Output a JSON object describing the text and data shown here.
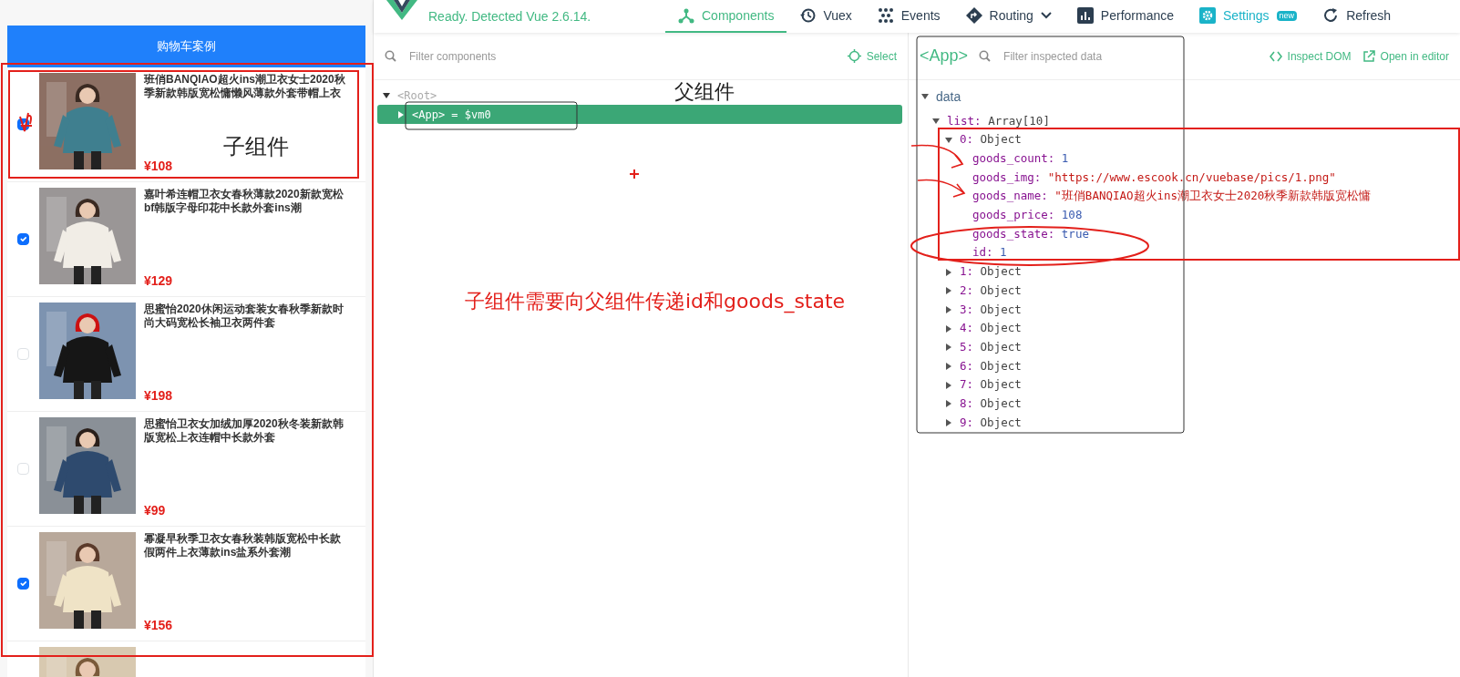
{
  "cart": {
    "title": "购物车案例",
    "items": [
      {
        "name": "班俏BANQIAO超火ins潮卫衣女士2020秋季新款韩版宽松慵懒风薄款外套带帽上衣",
        "price": "¥108",
        "checked": true
      },
      {
        "name": "嘉叶希连帽卫衣女春秋薄款2020新款宽松bf韩版字母印花中长款外套ins潮",
        "price": "¥129",
        "checked": true
      },
      {
        "name": "思蜜怡2020休闲运动套装女春秋季新款时尚大码宽松长袖卫衣两件套",
        "price": "¥198",
        "checked": false
      },
      {
        "name": "思蜜怡卫衣女加绒加厚2020秋冬装新款韩版宽松上衣连帽中长款外套",
        "price": "¥99",
        "checked": false
      },
      {
        "name": "幂凝早秋季卫衣女春秋装韩版宽松中长款假两件上衣薄款ins盐系外套潮",
        "price": "¥156",
        "checked": true
      }
    ]
  },
  "devtools": {
    "status": "Ready. Detected Vue 2.6.14.",
    "tabs": [
      {
        "label": "Components",
        "selected": true
      },
      {
        "label": "Vuex",
        "selected": false
      },
      {
        "label": "Events",
        "selected": false
      },
      {
        "label": "Routing",
        "selected": false,
        "dropdown": true
      },
      {
        "label": "Performance",
        "selected": false
      },
      {
        "label": "Settings",
        "selected": false,
        "badge": "new"
      },
      {
        "label": "Refresh",
        "selected": false
      }
    ],
    "components": {
      "placeholder": "Filter components",
      "select": "Select",
      "tree": [
        {
          "label": "<Root>",
          "expanded": true,
          "selected": false,
          "children": [
            {
              "label": "<App>",
              "suffix": "= $vm0",
              "expanded": false,
              "selected": true
            }
          ]
        }
      ]
    },
    "inspector": {
      "component": "<App>",
      "placeholder": "Filter inspected data",
      "actions": [
        "Inspect DOM",
        "Open in editor"
      ],
      "section": "data",
      "tree": [
        {
          "label": "list:",
          "value": "Array[10]",
          "color": "#444444",
          "expanded": true,
          "children": [
            {
              "label": "0:",
              "value": "Object",
              "color": "#444444",
              "expanded": true,
              "children": [
                {
                  "label": "goods_count:",
                  "value": "1",
                  "color": "#3a5bb0"
                },
                {
                  "label": "goods_img:",
                  "value": "\"https://www.escook.cn/vuebase/pics/1.png\"",
                  "color": "#c41a16"
                },
                {
                  "label": "goods_name:",
                  "value": "\"班俏BANQIAO超火ins潮卫衣女士2020秋季新款韩版宽松慵",
                  "color": "#c41a16"
                },
                {
                  "label": "goods_price:",
                  "value": "108",
                  "color": "#3a5bb0"
                },
                {
                  "label": "goods_state:",
                  "value": "true",
                  "color": "#3a5bb0"
                },
                {
                  "label": "id:",
                  "value": "1",
                  "color": "#3a5bb0"
                }
              ]
            },
            {
              "label": "1:",
              "value": "Object",
              "color": "#444444",
              "expanded": false
            },
            {
              "label": "2:",
              "value": "Object",
              "color": "#444444",
              "expanded": false
            },
            {
              "label": "3:",
              "value": "Object",
              "color": "#444444",
              "expanded": false
            },
            {
              "label": "4:",
              "value": "Object",
              "color": "#444444",
              "expanded": false
            },
            {
              "label": "5:",
              "value": "Object",
              "color": "#444444",
              "expanded": false
            },
            {
              "label": "6:",
              "value": "Object",
              "color": "#444444",
              "expanded": false
            },
            {
              "label": "7:",
              "value": "Object",
              "color": "#444444",
              "expanded": false
            },
            {
              "label": "8:",
              "value": "Object",
              "color": "#444444",
              "expanded": false
            },
            {
              "label": "9:",
              "value": "Object",
              "color": "#444444",
              "expanded": false
            }
          ]
        }
      ]
    }
  },
  "annotations": {
    "labels": [
      {
        "text": "子组件",
        "color": "#222222"
      },
      {
        "text": "父组件",
        "color": "#222222"
      },
      {
        "text": "子组件需要向父组件传递id和goods_state",
        "color": "#e3201b"
      }
    ],
    "marks": [
      {
        "kind": "frame",
        "color": "#e3201b"
      },
      {
        "kind": "frame",
        "color": "#e3201b"
      },
      {
        "kind": "scribble",
        "color": "#e3201b"
      },
      {
        "kind": "frame",
        "color": "#333333"
      },
      {
        "kind": "plus",
        "color": "#e3201b"
      },
      {
        "kind": "frame",
        "color": "#333333"
      },
      {
        "kind": "frame",
        "color": "#e3201b"
      },
      {
        "kind": "arrow",
        "color": "#e3201b"
      },
      {
        "kind": "arrow",
        "color": "#e3201b"
      },
      {
        "kind": "ellipse",
        "color": "#e3201b"
      }
    ]
  }
}
